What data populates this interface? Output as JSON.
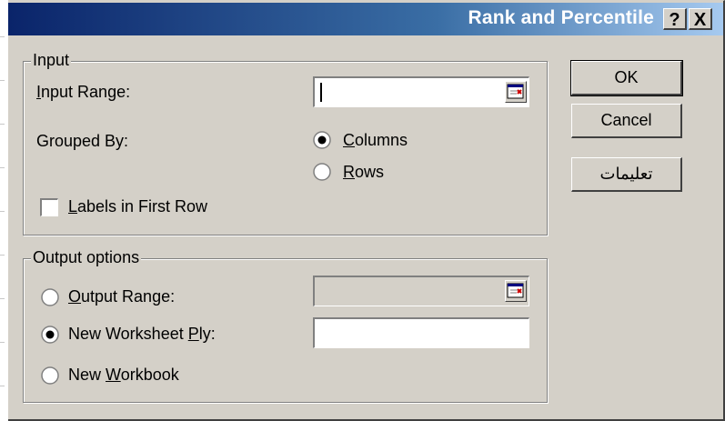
{
  "window": {
    "title": "Rank and Percentile",
    "help_glyph": "?",
    "close_glyph": "X"
  },
  "input_group": {
    "legend": "Input",
    "input_range_label": "Input Range:",
    "input_range_value": "",
    "grouped_by_label": "Grouped By:",
    "columns_label": "Columns",
    "columns_selected": true,
    "rows_label": "Rows",
    "rows_selected": false,
    "labels_first_row_label": "Labels in First Row",
    "labels_first_row_checked": false
  },
  "output_group": {
    "legend": "Output options",
    "output_range_label": "Output Range:",
    "output_range_selected": false,
    "output_range_value": "",
    "new_worksheet_label": "New Worksheet Ply:",
    "new_worksheet_selected": true,
    "new_worksheet_value": "",
    "new_workbook_label": "New Workbook",
    "new_workbook_selected": false
  },
  "buttons": {
    "ok": "OK",
    "cancel": "Cancel",
    "help": "تعليمات"
  },
  "icons": {
    "collapse_dialog": "collapse-dialog-icon"
  }
}
